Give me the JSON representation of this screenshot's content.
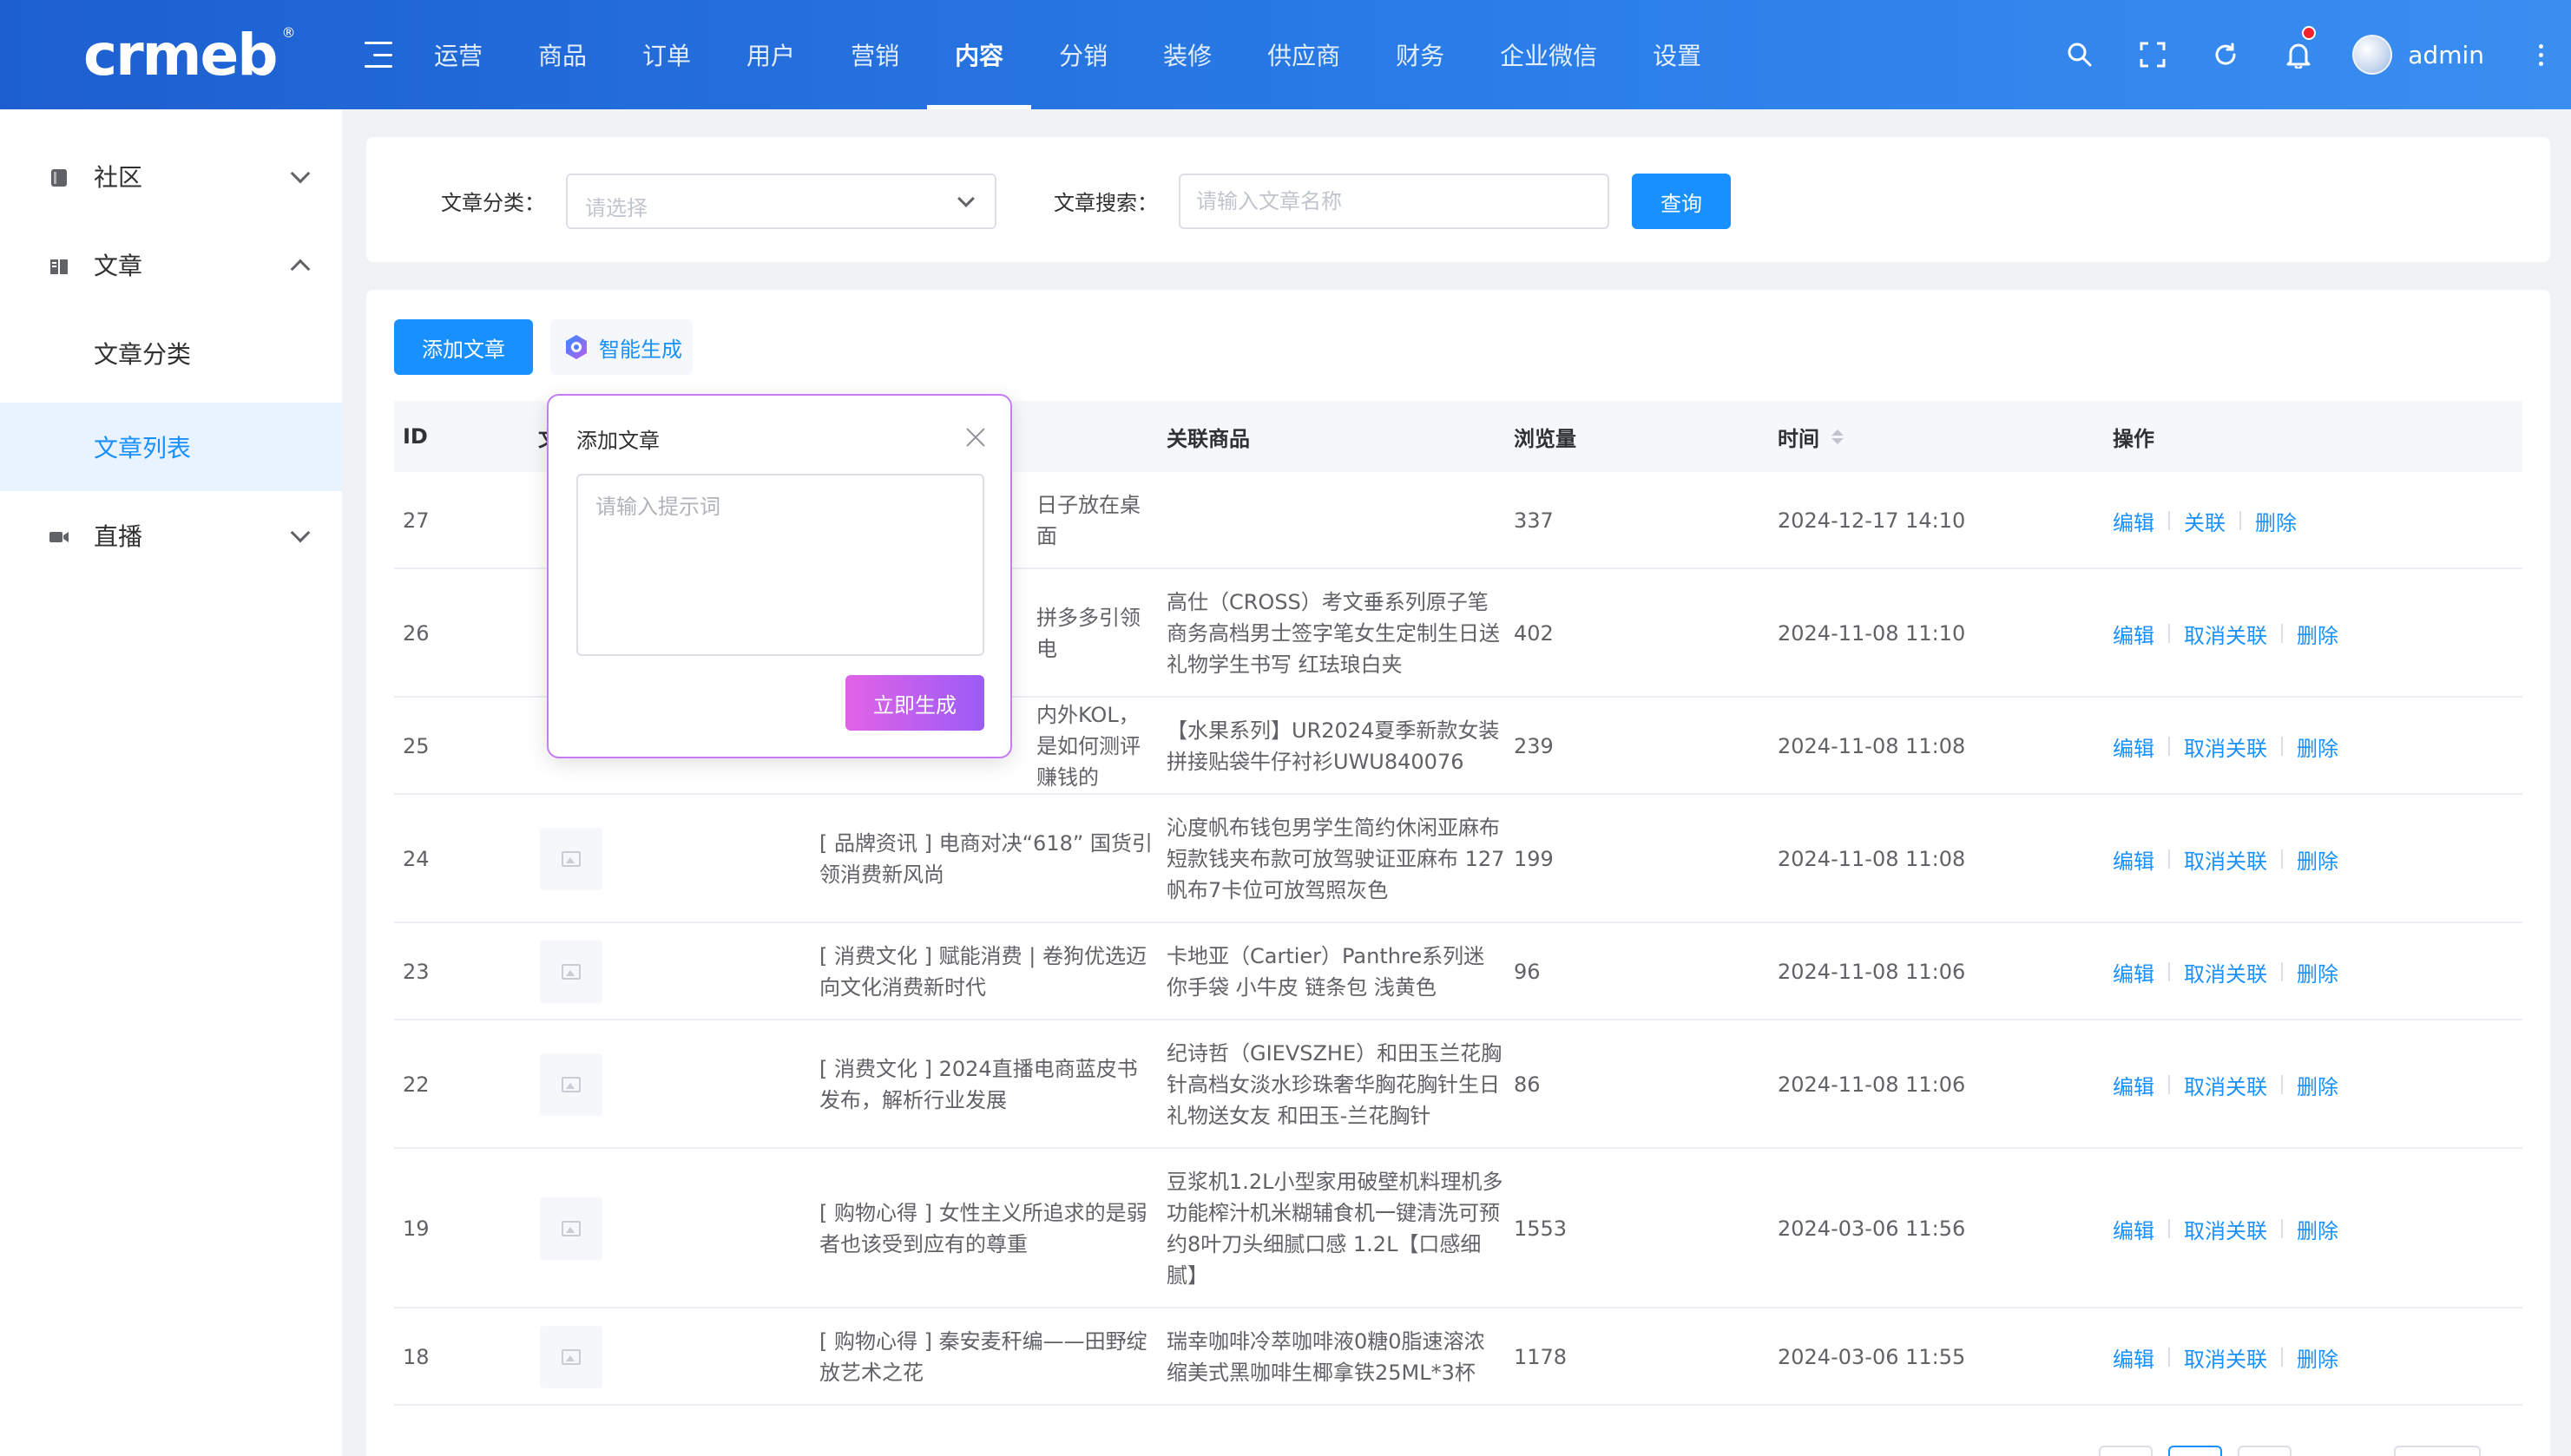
{
  "logo": {
    "text": "crmeb",
    "reg": "®"
  },
  "nav": {
    "items": [
      "运营",
      "商品",
      "订单",
      "用户",
      "营销",
      "内容",
      "分销",
      "装修",
      "供应商",
      "财务",
      "企业微信",
      "设置"
    ],
    "active_index": 5,
    "username": "admin"
  },
  "sidebar": {
    "groups": [
      {
        "label": "社区",
        "icon": "community-icon",
        "expanded": false
      },
      {
        "label": "文章",
        "icon": "article-icon",
        "expanded": true,
        "children": [
          "文章分类",
          "文章列表"
        ]
      },
      {
        "label": "直播",
        "icon": "video-camera-icon",
        "expanded": false
      }
    ],
    "active_child": "文章列表"
  },
  "filter": {
    "category_label": "文章分类：",
    "category_placeholder": "请选择",
    "search_label": "文章搜索：",
    "search_placeholder": "请输入文章名称",
    "query_label": "查询"
  },
  "toolbar": {
    "add_label": "添加文章",
    "ai_label": "智能生成"
  },
  "table": {
    "headers": {
      "id": "ID",
      "image": "文",
      "title": "",
      "product": "关联商品",
      "views": "浏览量",
      "time": "时间",
      "actions": "操作"
    },
    "rows": [
      {
        "id": "27",
        "title": "日子放在桌面",
        "product": "",
        "views": "337",
        "time": "2024-12-17 14:10",
        "ops": [
          "编辑",
          "关联",
          "删除"
        ]
      },
      {
        "id": "26",
        "title": "拼多多引领电",
        "product": "高仕（CROSS）考文垂系列原子笔商务高档男士签字笔女生定制生日送礼物学生书写 红珐琅白夹",
        "views": "402",
        "time": "2024-11-08 11:10",
        "ops": [
          "编辑",
          "取消关联",
          "删除"
        ]
      },
      {
        "id": "25",
        "title": "内外KOL，是如何测评赚钱的",
        "product": "【水果系列】UR2024夏季新款女装拼接贴袋牛仔衬衫UWU840076",
        "views": "239",
        "time": "2024-11-08 11:08",
        "ops": [
          "编辑",
          "取消关联",
          "删除"
        ]
      },
      {
        "id": "24",
        "title": "[ 品牌资讯 ] 电商对决“618” 国货引领消费新风尚",
        "product": "沁度帆布钱包男学生简约休闲亚麻布短款钱夹布款可放驾驶证亚麻布 127 帆布7卡位可放驾照灰色",
        "views": "199",
        "time": "2024-11-08 11:08",
        "ops": [
          "编辑",
          "取消关联",
          "删除"
        ]
      },
      {
        "id": "23",
        "title": "[ 消费文化 ] 赋能消费 | 卷狗优选迈向文化消费新时代",
        "product": "卡地亚（Cartier）Panthre系列迷你手袋 小牛皮 链条包 浅黄色",
        "views": "96",
        "time": "2024-11-08 11:06",
        "ops": [
          "编辑",
          "取消关联",
          "删除"
        ]
      },
      {
        "id": "22",
        "title": "[ 消费文化 ] 2024直播电商蓝皮书发布，解析行业发展",
        "product": "纪诗哲（GIEVSZHE）和田玉兰花胸针高档女淡水珍珠奢华胸花胸针生日礼物送女友 和田玉-兰花胸针",
        "views": "86",
        "time": "2024-11-08 11:06",
        "ops": [
          "编辑",
          "取消关联",
          "删除"
        ]
      },
      {
        "id": "19",
        "title": "[ 购物心得 ] 女性主义所追求的是弱者也该受到应有的尊重",
        "product": "豆浆机1.2L小型家用破壁机料理机多功能榨汁机米糊辅食机一键清洗可预约8叶刀头细腻口感 1.2L【口感细腻】",
        "views": "1553",
        "time": "2024-03-06 11:56",
        "ops": [
          "编辑",
          "取消关联",
          "删除"
        ]
      },
      {
        "id": "18",
        "title": "[ 购物心得 ] 秦安麦秆编——田野绽放艺术之花",
        "product": "瑞幸咖啡冷萃咖啡液0糖0脂速溶浓缩美式黑咖啡生椰拿铁25ML*3杯",
        "views": "1178",
        "time": "2024-03-06 11:55",
        "ops": [
          "编辑",
          "取消关联",
          "删除"
        ]
      }
    ]
  },
  "popover": {
    "title": "添加文章",
    "prompt_placeholder": "请输入提示词",
    "generate_label": "立即生成"
  },
  "colors": {
    "primary": "#1890ff",
    "topbar": "#1d5fd0",
    "ai_gradient_start": "#e163e6",
    "ai_gradient_end": "#9b5cf6"
  }
}
